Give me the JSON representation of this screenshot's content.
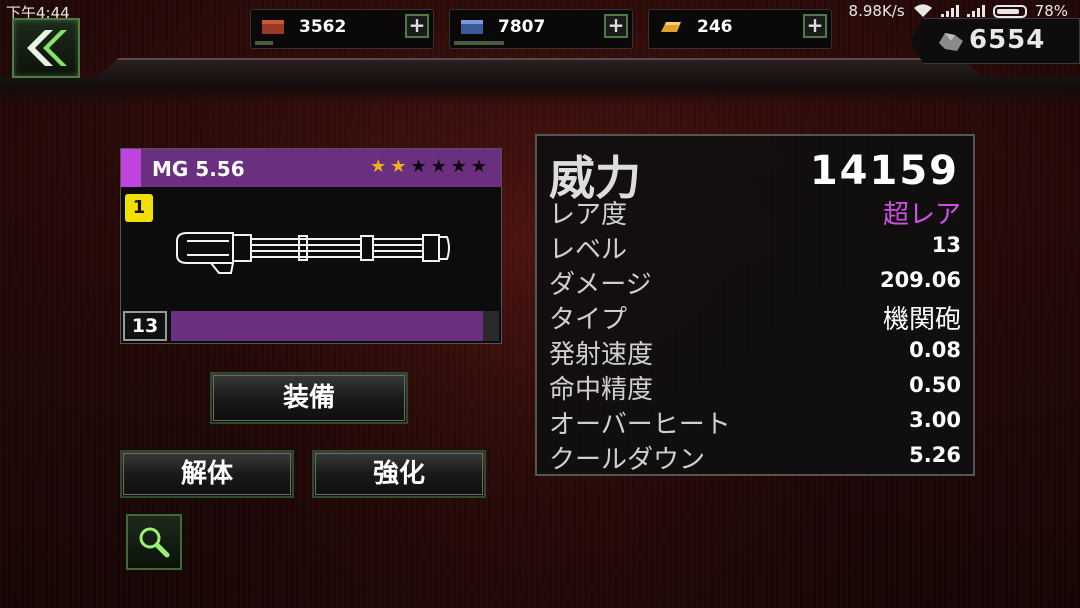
{
  "status_bar": {
    "time": "下午4:44",
    "speed": "8.98K/s",
    "battery": "78%"
  },
  "resources": [
    {
      "name": "red-crate",
      "value": "3562",
      "color": "#b0442c"
    },
    {
      "name": "blue-crate",
      "value": "7807",
      "color": "#5a7ac0"
    },
    {
      "name": "gold-bars",
      "value": "246",
      "color": "#e0a030"
    }
  ],
  "gems": {
    "value": "6554"
  },
  "weapon": {
    "name": "MG 5.56",
    "slot": "1",
    "level": "13",
    "stars_filled": 2,
    "stars_total": 6,
    "xp_fraction": 0.95,
    "rarity_color": "#6a2f7e"
  },
  "buttons": {
    "equip": "装備",
    "dismantle": "解体",
    "enhance": "強化"
  },
  "stats": {
    "title": "威力",
    "power": "14159",
    "rows": [
      {
        "label": "レア度",
        "value": "超レア"
      },
      {
        "label": "レベル",
        "value": "13"
      },
      {
        "label": "ダメージ",
        "value": "209.06"
      },
      {
        "label": "タイプ",
        "value": "機関砲"
      },
      {
        "label": "発射速度",
        "value": "0.08"
      },
      {
        "label": "命中精度",
        "value": "0.50"
      },
      {
        "label": "オーバーヒート",
        "value": "3.00"
      },
      {
        "label": "クールダウン",
        "value": "5.26"
      }
    ]
  }
}
